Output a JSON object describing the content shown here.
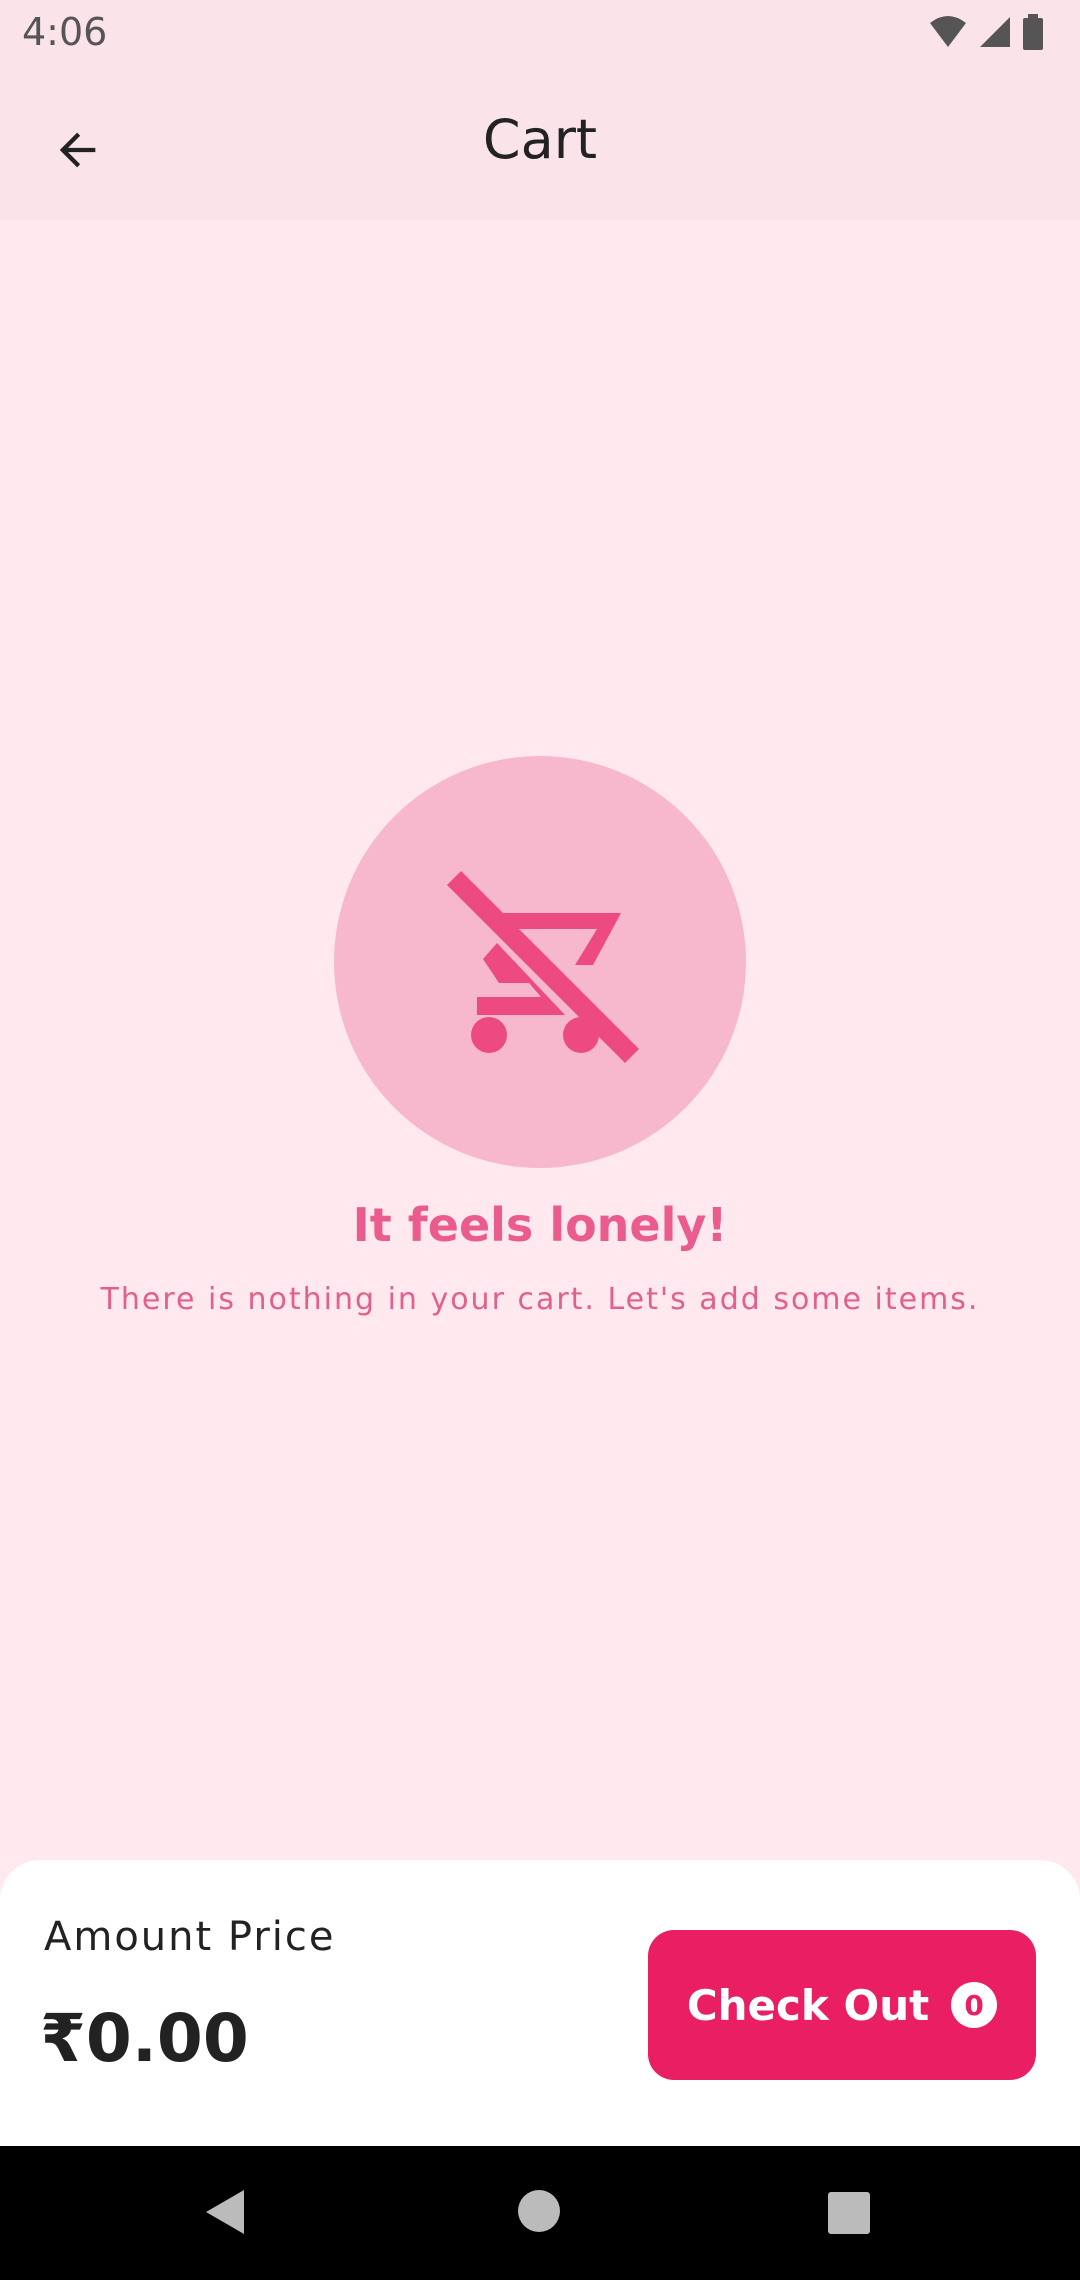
{
  "status_bar": {
    "time": "4:06"
  },
  "app_bar": {
    "title": "Cart"
  },
  "empty_state": {
    "title": "It feels lonely!",
    "subtitle": "There is nothing in your cart. Let's add some items.",
    "icon": "remove-shopping-cart-icon"
  },
  "bottom_bar": {
    "amount_label": "Amount Price",
    "amount_value": "₹0.00",
    "checkout_label": "Check Out",
    "checkout_count": "0"
  },
  "colors": {
    "accent": "#e91e63",
    "background": "#ffe9ee",
    "app_bar": "#fbe3ea",
    "icon_circle": "#f7b8cd",
    "empty_text": "#ea5b8e"
  }
}
